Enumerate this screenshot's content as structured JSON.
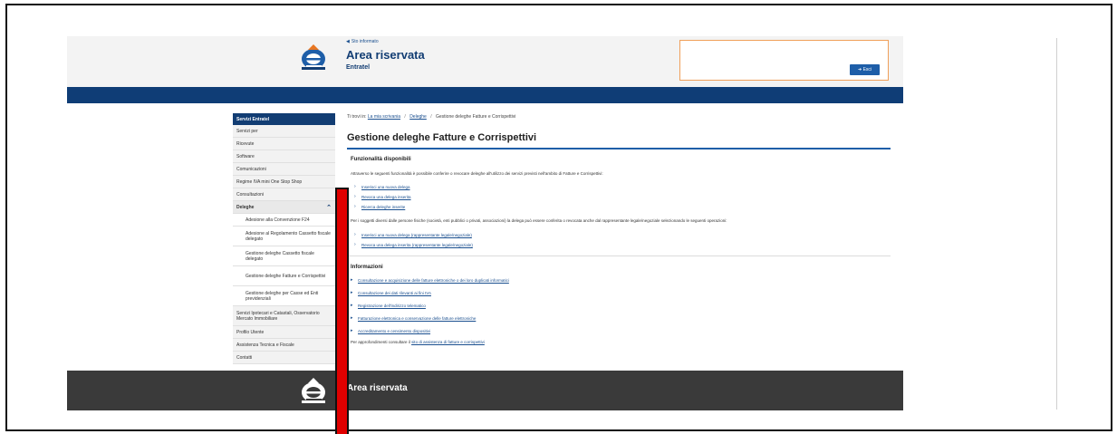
{
  "header": {
    "info_link": "Sto informato",
    "title": "Area riservata",
    "subtitle": "Entratel",
    "exit_button": "Esci"
  },
  "sidebar": {
    "heading": "Servizi Entratel",
    "items": [
      {
        "label": "Servizi per"
      },
      {
        "label": "Ricevute"
      },
      {
        "label": "Software"
      },
      {
        "label": "Comunicazioni"
      },
      {
        "label": "Regime IVA mini One Stop Shop"
      },
      {
        "label": "Consultazioni"
      },
      {
        "label": "Deleghe"
      },
      {
        "label": "Adesione alla Convenzione F24"
      },
      {
        "label": "Adesione al Regolamento Cassetto fiscale delegato"
      },
      {
        "label": "Gestione deleghe Cassetto fiscale delegato"
      },
      {
        "label": "Gestione deleghe Fatture e Corrispettivi"
      },
      {
        "label": "Gestione deleghe per Casse ed Enti previdenziali"
      },
      {
        "label": "Servizi Ipotecari e Catastali, Osservatorio Mercato Immobiliare"
      },
      {
        "label": "Profilo Utente"
      },
      {
        "label": "Assistenza Tecnica e Fiscale"
      },
      {
        "label": "Contatti"
      }
    ]
  },
  "breadcrumb": {
    "prefix": "Ti trovi in:",
    "home": "La mia scrivania",
    "deleghe": "Deleghe",
    "current": "Gestione deleghe Fatture e Corrispettivi"
  },
  "main": {
    "title": "Gestione deleghe Fatture e Corrispettivi",
    "func_title": "Funzionalità disponibili",
    "func_intro": "Attraverso le seguenti funzionalità è possibile conferire o revocare deleghe all'utilizzo dei servizi previsti nell'ambito di Fatture e Corrispettivi:",
    "func_links": [
      {
        "label": "Inserisci una nuova delega"
      },
      {
        "label": "Revoca una delega inserita"
      },
      {
        "label": "Ricerca deleghe inserite"
      }
    ],
    "other_intro": "Per i soggetti diversi dalle persone fisiche (società, enti pubblici o privati, associazioni) la delega può essere conferita o revocata anche dal rappresentante legale/negoziale selezionando le seguenti operazioni:",
    "other_links": [
      {
        "label": "Inserisci una nuova delega (rappresentante legale/negoziale)"
      },
      {
        "label": "Revoca una delega inserita (rappresentante legale/negoziale)"
      }
    ],
    "info_title": "Informazioni",
    "info_links": [
      {
        "label": "Consultazione e acquisizione delle fatture elettroniche o dei loro duplicati informatici"
      },
      {
        "label": "Consultazione dei dati rilevanti ai fini IVA"
      },
      {
        "label": "Registrazione dell'indirizzo telematico"
      },
      {
        "label": "Fatturazione elettronica e conservazione delle fatture elettroniche"
      },
      {
        "label": "Accreditamento e censimento dispositivi"
      }
    ],
    "footer_prefix": "Per approfondimenti consultare il",
    "footer_link": "sito di assistenza di fatture e corrispettivi"
  },
  "footer": {
    "title": "Area riservata"
  },
  "colors": {
    "brand_dark": "#123d73",
    "nav_blue": "#0f3d76",
    "link": "#1a4f8f",
    "footer": "#3a3a3a",
    "marker": "#e00000",
    "user_box_border": "#f0a05a"
  },
  "icons": {
    "logo": "agenzia-entrate-logo-icon",
    "exit": "logout-icon",
    "chevron": "chevron-up-icon"
  }
}
